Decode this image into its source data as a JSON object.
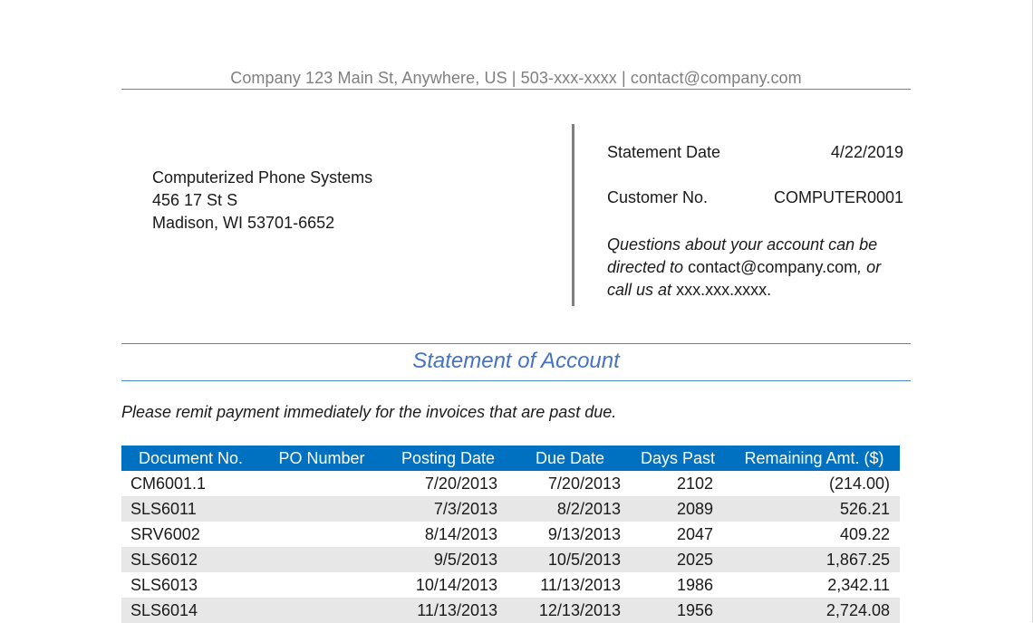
{
  "header": {
    "company_line": "Company 123 Main St, Anywhere, US | 503-xxx-xxxx | contact@company.com"
  },
  "customer": {
    "name": "Computerized Phone Systems",
    "address_line1": "456 17 St S",
    "address_line2": "Madison, WI  53701-6652"
  },
  "info": {
    "statement_date_label": "Statement Date",
    "statement_date": "4/22/2019",
    "customer_no_label": "Customer No.",
    "customer_no": "COMPUTER0001",
    "questions_part1": "Questions about your account can be directed to",
    "questions_email": "contact@company.com",
    "questions_part2": ", or call us at",
    "questions_phone": "xxx.xxx.xxxx."
  },
  "section_title": "Statement of Account",
  "remit_note": "Please remit payment immediately for the invoices that are past due.",
  "table": {
    "headers": [
      "Document No.",
      "PO Number",
      "Posting Date",
      "Due Date",
      "Days Past",
      "Remaining Amt. ($)"
    ],
    "rows": [
      [
        "CM6001.1",
        "",
        "7/20/2013",
        "7/20/2013",
        "2102",
        "(214.00)"
      ],
      [
        "SLS6011",
        "",
        "7/3/2013",
        "8/2/2013",
        "2089",
        "526.21"
      ],
      [
        "SRV6002",
        "",
        "8/14/2013",
        "9/13/2013",
        "2047",
        "409.22"
      ],
      [
        "SLS6012",
        "",
        "9/5/2013",
        "10/5/2013",
        "2025",
        "1,867.25"
      ],
      [
        "SLS6013",
        "",
        "10/14/2013",
        "11/13/2013",
        "1986",
        "2,342.11"
      ],
      [
        "SLS6014",
        "",
        "11/13/2013",
        "12/13/2013",
        "1956",
        "2,724.08"
      ]
    ]
  },
  "colors": {
    "table_header_bg": "#0070c0",
    "title_text": "#4472c4",
    "alt_row_bg": "#e7e7e7",
    "header_text": "#7f7f7f"
  }
}
